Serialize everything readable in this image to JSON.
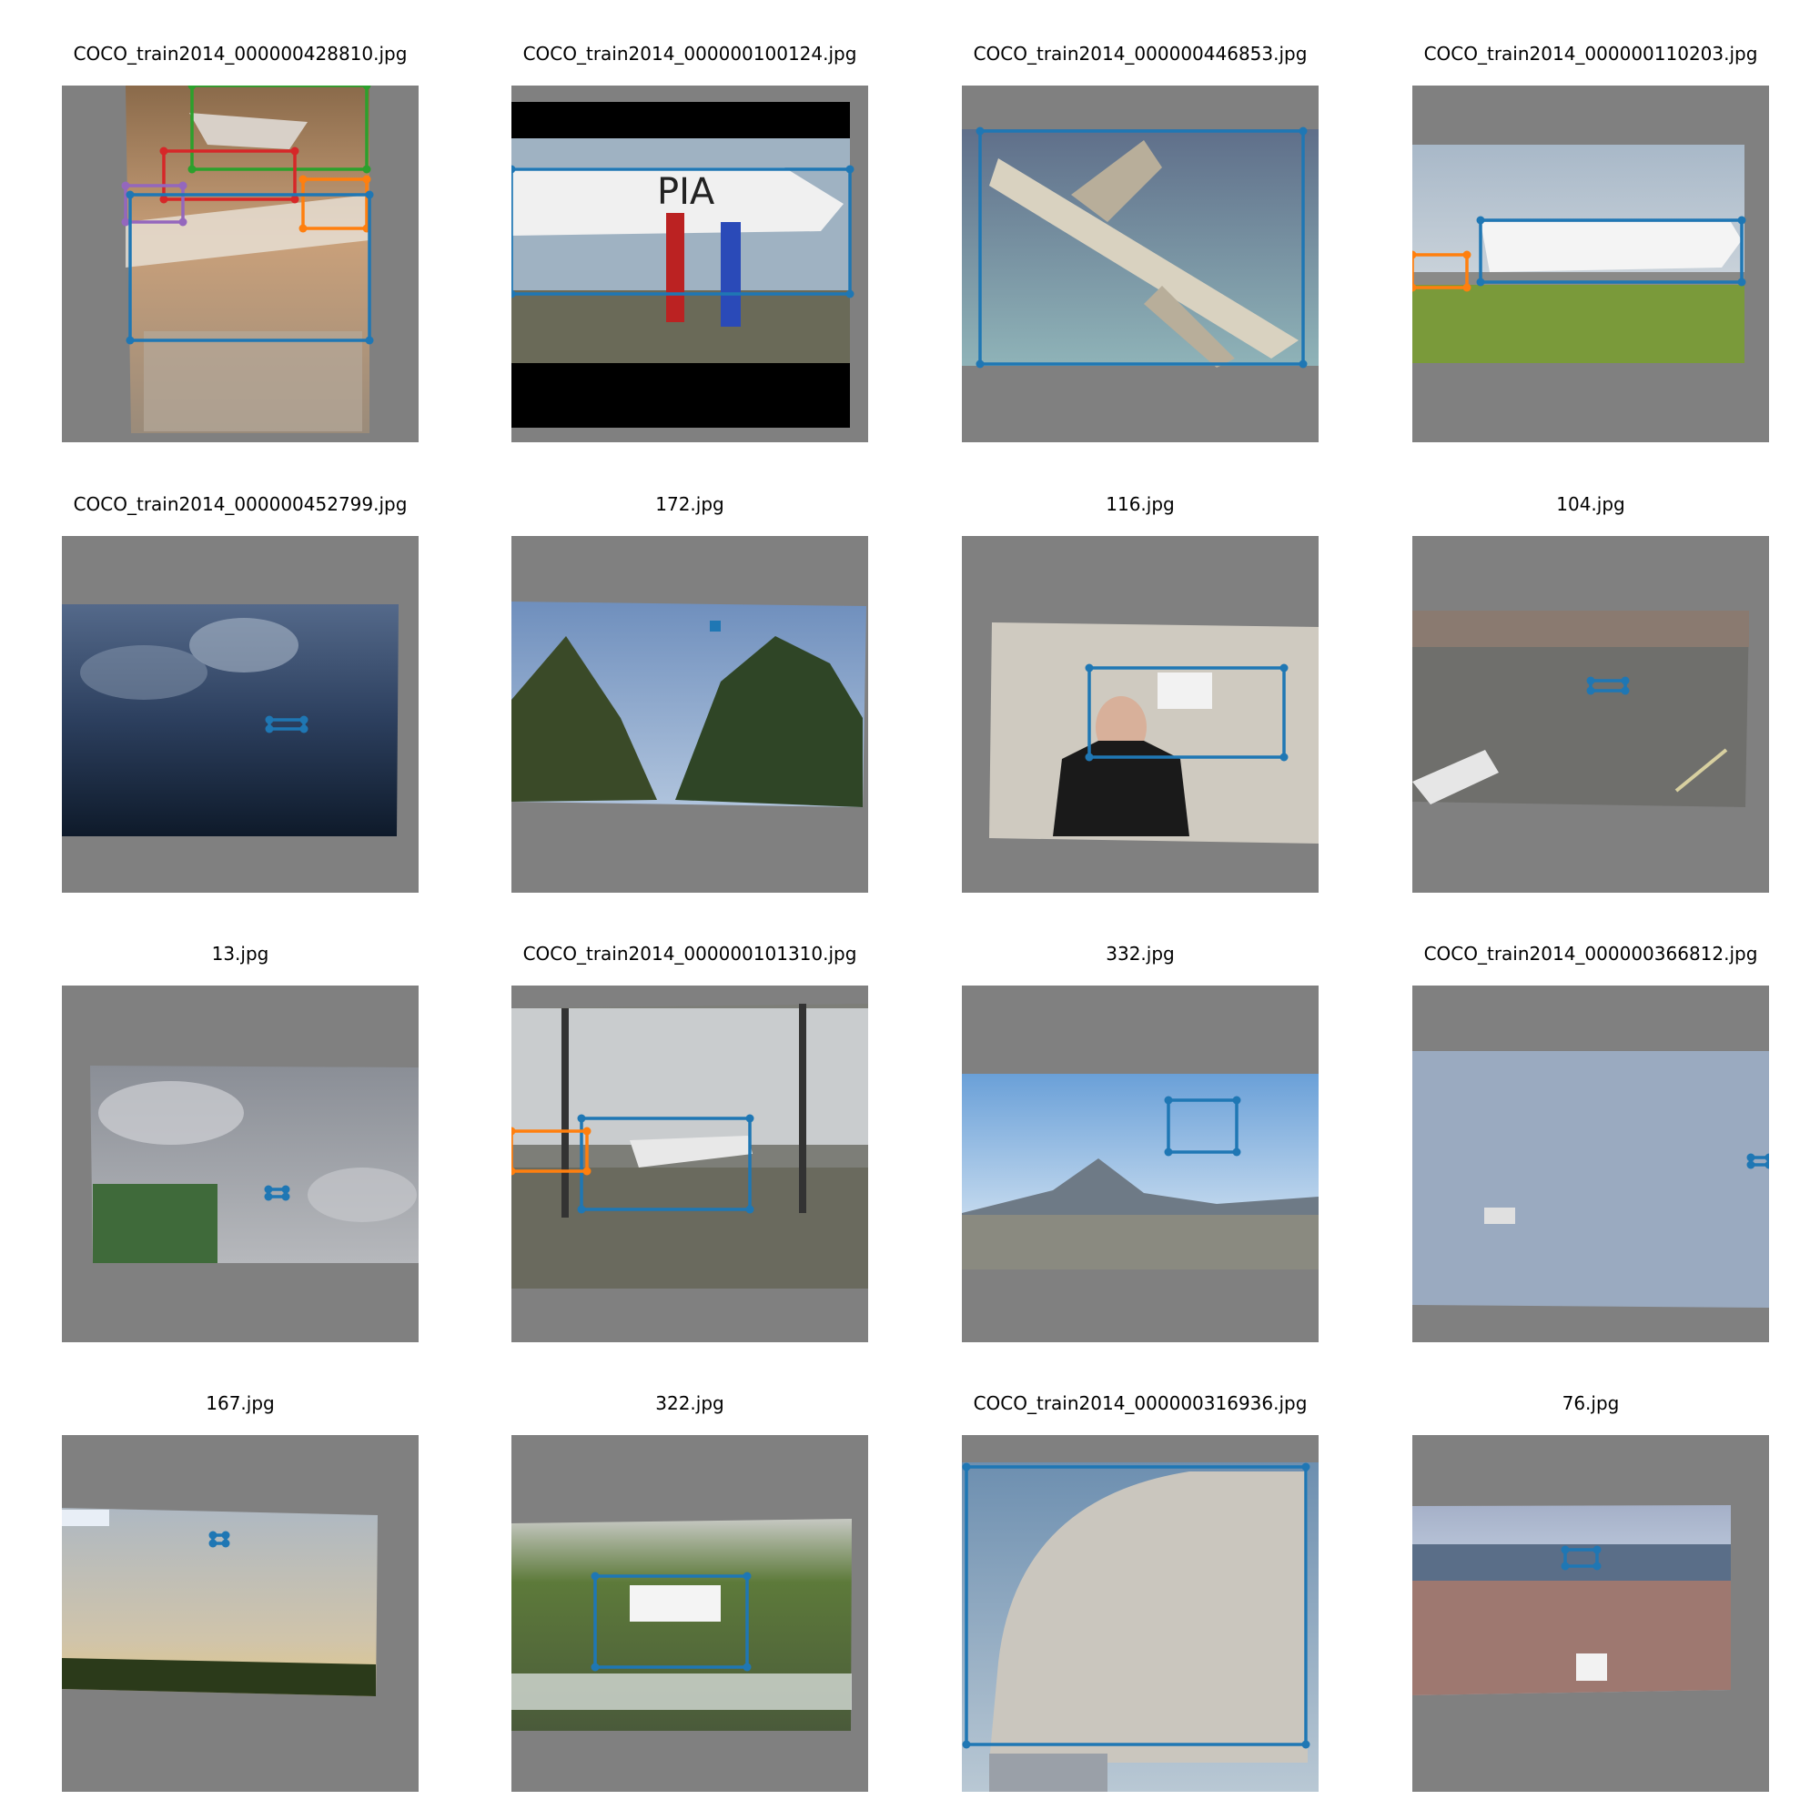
{
  "colors": {
    "pad": "#808080",
    "box_palette": [
      "#1f77b4",
      "#ff7f0e",
      "#2ca02c",
      "#d62728",
      "#9467bd"
    ]
  },
  "images": [
    {
      "title": "COCO_train2014_000000428810.jpg",
      "scene": "hangar",
      "box_count": 5
    },
    {
      "title": "COCO_train2014_000000100124.jpg",
      "scene": "airliner-spectators",
      "box_count": 1
    },
    {
      "title": "COCO_train2014_000000446853.jpg",
      "scene": "vintage-illustration",
      "box_count": 1
    },
    {
      "title": "COCO_train2014_000000110203.jpg",
      "scene": "runway-airliner",
      "box_count": 2
    },
    {
      "title": "COCO_train2014_000000452799.jpg",
      "scene": "dark-clouds",
      "box_count": 1
    },
    {
      "title": "172.jpg",
      "scene": "trees-sky",
      "box_count": 1
    },
    {
      "title": "116.jpg",
      "scene": "drone-operator",
      "box_count": 1
    },
    {
      "title": "104.jpg",
      "scene": "parking-lot",
      "box_count": 1
    },
    {
      "title": "13.jpg",
      "scene": "cloudy-sky-tablet",
      "box_count": 1
    },
    {
      "title": "COCO_train2014_000000101310.jpg",
      "scene": "airport-window",
      "box_count": 2
    },
    {
      "title": "332.jpg",
      "scene": "mountain-city",
      "box_count": 1
    },
    {
      "title": "COCO_train2014_000000366812.jpg",
      "scene": "pale-sky",
      "box_count": 1
    },
    {
      "title": "167.jpg",
      "scene": "dusk-field",
      "box_count": 1
    },
    {
      "title": "322.jpg",
      "scene": "drone-greenery",
      "box_count": 1
    },
    {
      "title": "COCO_train2014_000000316936.jpg",
      "scene": "jumbo-nose",
      "box_count": 1
    },
    {
      "title": "76.jpg",
      "scene": "beach",
      "box_count": 1
    }
  ]
}
